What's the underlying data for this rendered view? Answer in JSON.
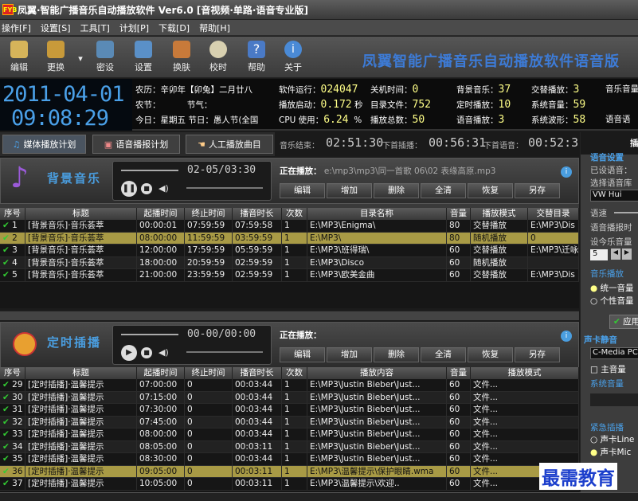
{
  "window": {
    "title": "凤翼·智能广播音乐自动播放软件 Ver6.0 [音视频·单路·语音专业版]",
    "logo": "FYB"
  },
  "menu": [
    "操作[F]",
    "设置[S]",
    "工具[T]",
    "计划[P]",
    "下载[D]",
    "帮助[H]"
  ],
  "toolbar": {
    "edit": "编辑",
    "swap": "更换",
    "password": "密设",
    "settings": "设置",
    "skin": "换肤",
    "time": "校时",
    "help": "帮助",
    "about": "关于"
  },
  "brand": "凤翼智能广播音乐自动播放软件语音版",
  "clock": {
    "date": "2011-04-01",
    "time": "09:08:29"
  },
  "lunar": {
    "l1": "农历：辛卯年【卯兔】二月廿八",
    "l2": "农节：          节气：",
    "l3": "今日：星期五  节日：愚人节(全国"
  },
  "stats": {
    "run_l": "软件运行：",
    "run_v": "024047",
    "boot_l": "播放启动：",
    "boot_v": "0.172",
    "boot_u": "秒",
    "cpu_l": "CPU 使用：",
    "cpu_v": "6.24",
    "cpu_u": "%",
    "shut_l": "关机时间：",
    "shut_v": "0",
    "dir_l": "目录文件：",
    "dir_v": "752",
    "total_l": "播放总数：",
    "total_v": "50",
    "bg_l": "背景音乐：",
    "bg_v": "37",
    "timed_l": "定时播放：",
    "timed_v": "10",
    "voice_l": "语音播放：",
    "voice_v": "3",
    "alt_l": "交替播放：",
    "alt_v": "3",
    "sysvol_l": "系统音量：",
    "sysvol_v": "59",
    "wave_l": "系统波形：",
    "wave_v": "58",
    "mv_l": "音乐音量",
    "vv_l": "语音语"
  },
  "tabs": {
    "media": "媒体播放计划",
    "voice": "语音播报计划",
    "manual": "人工播放曲目"
  },
  "playing": {
    "music_end": "音乐结束：",
    "music_end_v": "02:51:30",
    "next_insert": "下首插播：",
    "next_insert_v": "00:56:31",
    "next_voice": "下首语音：",
    "next_voice_v": "00:52:31"
  },
  "bg": {
    "title": "背景音乐",
    "date": "02-05/03:30",
    "now_k": "正在播放：",
    "now_v": "e:\\mp3\\mp3\\同一首歌 06\\02  表缘高原.mp3",
    "actions": [
      "编辑",
      "增加",
      "删除",
      "全清",
      "恢复",
      "另存"
    ],
    "cols": [
      "序号",
      "标题",
      "起播时间",
      "终止时间",
      "播音时长",
      "次数",
      "目录名称",
      "音量",
      "播放模式",
      "交替目录"
    ],
    "rows": [
      [
        "1",
        "[背景音乐]·音乐荟萃",
        "00:00:01",
        "07:59:59",
        "07:59:58",
        "1",
        "E:\\MP3\\Enigma\\",
        "80",
        "交替播放",
        "E:\\MP3\\Dis"
      ],
      [
        "2",
        "[背景音乐]·音乐荟萃",
        "08:00:00",
        "11:59:59",
        "03:59:59",
        "1",
        "E:\\MP3\\",
        "80",
        "随机播放",
        "0"
      ],
      [
        "3",
        "[背景音乐]·音乐荟萃",
        "12:00:00",
        "17:59:59",
        "05:59:59",
        "1",
        "E:\\MP3\\班得瑞\\",
        "60",
        "交替播放",
        "E:\\MP3\\迁咏"
      ],
      [
        "4",
        "[背景音乐]·音乐荟萃",
        "18:00:00",
        "20:59:59",
        "02:59:59",
        "1",
        "E:\\MP3\\Disco",
        "60",
        "随机播放",
        ""
      ],
      [
        "5",
        "[背景音乐]·音乐荟萃",
        "21:00:00",
        "23:59:59",
        "02:59:59",
        "1",
        "E:\\MP3\\欧美金曲",
        "60",
        "交替播放",
        "E:\\MP3\\Dis"
      ]
    ]
  },
  "timed": {
    "title": "定时插播",
    "date": "00-00/00:00",
    "now_k": "正在播放：",
    "now_v": "",
    "actions": [
      "编辑",
      "增加",
      "删除",
      "全清",
      "恢复",
      "另存"
    ],
    "cols": [
      "序号",
      "标题",
      "起播时间",
      "终止时间",
      "播音时长",
      "次数",
      "播放内容",
      "音量",
      "播放模式"
    ],
    "rows": [
      [
        "29",
        "[定时插播]·温馨提示",
        "07:00:00",
        "0",
        "00:03:44",
        "1",
        "E:\\MP3\\Justin Bieber\\Just...",
        "60",
        "文件..."
      ],
      [
        "30",
        "[定时插播]·温馨提示",
        "07:15:00",
        "0",
        "00:03:44",
        "1",
        "E:\\MP3\\Justin Bieber\\Just...",
        "60",
        "文件..."
      ],
      [
        "31",
        "[定时插播]·温馨提示",
        "07:30:00",
        "0",
        "00:03:44",
        "1",
        "E:\\MP3\\Justin Bieber\\Just...",
        "60",
        "文件..."
      ],
      [
        "32",
        "[定时插播]·温馨提示",
        "07:45:00",
        "0",
        "00:03:44",
        "1",
        "E:\\MP3\\Justin Bieber\\Just...",
        "60",
        "文件..."
      ],
      [
        "33",
        "[定时插播]·温馨提示",
        "08:00:00",
        "0",
        "00:03:44",
        "1",
        "E:\\MP3\\Justin Bieber\\Just...",
        "60",
        "文件..."
      ],
      [
        "34",
        "[定时插播]·温馨提示",
        "08:05:00",
        "0",
        "00:03:11",
        "1",
        "E:\\MP3\\Justin Bieber\\Just...",
        "60",
        "文件..."
      ],
      [
        "35",
        "[定时插播]·温馨提示",
        "08:30:00",
        "0",
        "00:03:44",
        "1",
        "E:\\MP3\\Justin Bieber\\Just...",
        "60",
        "文件..."
      ],
      [
        "36",
        "[定时插播]·温馨提示",
        "09:05:00",
        "0",
        "00:03:11",
        "1",
        "E:\\MP3\\温馨提示\\保护眼睛.wma",
        "60",
        "文件..."
      ],
      [
        "37",
        "[定时插播]·温馨提示",
        "10:05:00",
        "0",
        "00:03:11",
        "1",
        "E:\\MP3\\温馨提示\\欢迎..",
        "60",
        "文件..."
      ]
    ]
  },
  "side": {
    "tab": "插",
    "voice_set": "语音设置",
    "set_voice": "已设语音：",
    "lib": "选择语音库",
    "lib_v": "VW Hui",
    "speed": "语速",
    "vol_prop": "语音播报时",
    "vol_set": "设今乐音量",
    "num": "5",
    "play_mode": "音乐播放",
    "opt1": "统一音量",
    "opt2": "个性音量",
    "apply": "应用",
    "card_mute": "声卡静音",
    "card_v": "C-Media PC",
    "main_vol": "主音量",
    "sys_vol": "系统音量",
    "emerg": "紧急插播",
    "line": "声卡Line",
    "mic": "声卡Mic"
  },
  "watermark": "最需教育"
}
